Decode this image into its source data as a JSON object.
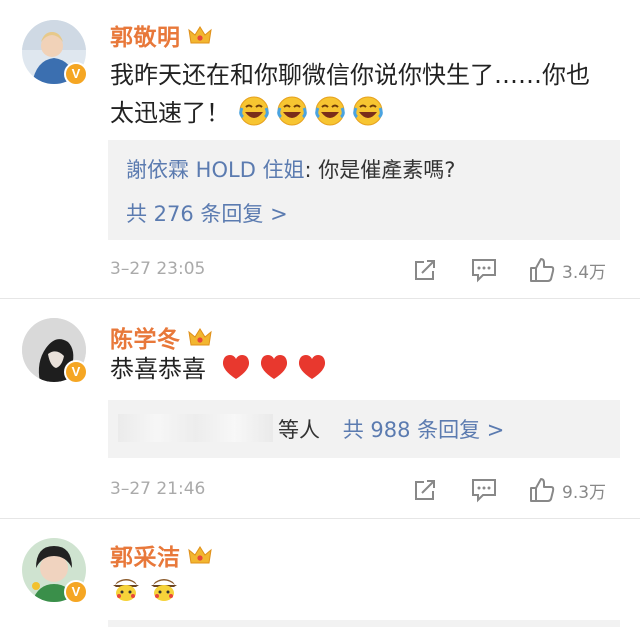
{
  "comments": [
    {
      "name": "郭敬明",
      "text": "我昨天还在和你聊微信你说你快生了……你也太迅速了！",
      "emojis": [
        "laugh-cry-emoji",
        "laugh-cry-emoji",
        "laugh-cry-emoji",
        "laugh-cry-emoji"
      ],
      "reply_author": "謝依霖 HOLD 住姐",
      "reply_text": ": 你是催產素嗎?",
      "reply_more": "共 276 条回复 >",
      "time": "3–27 23:05",
      "likes": "3.4万"
    },
    {
      "name": "陈学冬",
      "text": "恭喜恭喜",
      "emojis": [
        "heart-emoji",
        "heart-emoji",
        "heart-emoji"
      ],
      "reply_blurred": "等人",
      "reply_more": "共 988 条回复 >",
      "time": "3–27 21:46",
      "likes": "9.3万"
    },
    {
      "name": "郭采洁",
      "emojis": [
        "pikachu-detective-emoji",
        "pikachu-detective-emoji"
      ]
    }
  ],
  "colors": {
    "name": "#e8783a",
    "link": "#5b7bb0",
    "meta": "#aaaaaa",
    "reply_bg": "#f2f2f2",
    "vip": "#f5a623"
  },
  "icons": {
    "verified": "v-badge",
    "vip": "crown-icon",
    "share": "share-icon",
    "comment": "comment-icon",
    "like": "thumbs-up-icon"
  },
  "badge_letter": "V"
}
